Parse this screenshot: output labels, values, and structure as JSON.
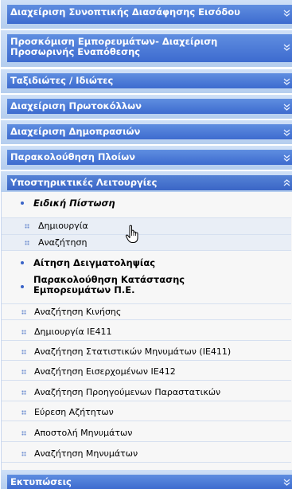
{
  "sections": [
    {
      "title": "Διαχείριση Συνοπτικής Διασάφησης Εισόδου",
      "expanded": false
    },
    {
      "title": "Προσκόμιση Εμπορευμάτων- Διαχείριση Προσωρινής Εναπόθεσης",
      "expanded": false
    },
    {
      "title": "Ταξιδιώτες / Ιδιώτες",
      "expanded": false
    },
    {
      "title": "Διαχείριση Πρωτοκόλλων",
      "expanded": false
    },
    {
      "title": "Διαχείριση Δημοπρασιών",
      "expanded": false
    },
    {
      "title": "Παρακολούθηση Πλοίων",
      "expanded": false
    },
    {
      "title": "Υποστηρικτικές Λειτουργίες",
      "expanded": true
    },
    {
      "title": "Εκτυπώσεις",
      "expanded": false
    }
  ],
  "support_items": [
    {
      "label": "Ειδική Πίστωση",
      "kind": "group"
    },
    {
      "label": "Δημιουργία",
      "kind": "sub"
    },
    {
      "label": "Αναζήτηση",
      "kind": "sub"
    },
    {
      "label": "Αίτηση Δειγματοληψίας",
      "kind": "group"
    },
    {
      "label": "Παρακολούθηση Κατάστασης Εμπορευμάτων Π.Ε.",
      "kind": "group"
    },
    {
      "label": "Αναζήτηση Κινήσης",
      "kind": "item"
    },
    {
      "label": "Δημιουργία IE411",
      "kind": "item"
    },
    {
      "label": "Αναζήτηση Στατιστικών Μηνυμάτων (IE411)",
      "kind": "item"
    },
    {
      "label": "Αναζήτηση Εισερχομένων IE412",
      "kind": "item"
    },
    {
      "label": "Αναζήτηση Προηγούμενων Παραστατικών",
      "kind": "item"
    },
    {
      "label": "Εύρεση Αζήτητων",
      "kind": "item"
    },
    {
      "label": "Αποστολή Μηνυμάτων",
      "kind": "item"
    },
    {
      "label": "Αναζήτηση Μηνυμάτων",
      "kind": "item"
    }
  ],
  "icons": {
    "collapsed": "chevron-double-down-icon",
    "expanded": "chevron-double-up-icon",
    "cursor": "hand-pointer-icon"
  },
  "colors": {
    "header_bar": "#4a7ad8",
    "header_frame": "#c4d8f4",
    "bullet": "#3a64c8"
  }
}
